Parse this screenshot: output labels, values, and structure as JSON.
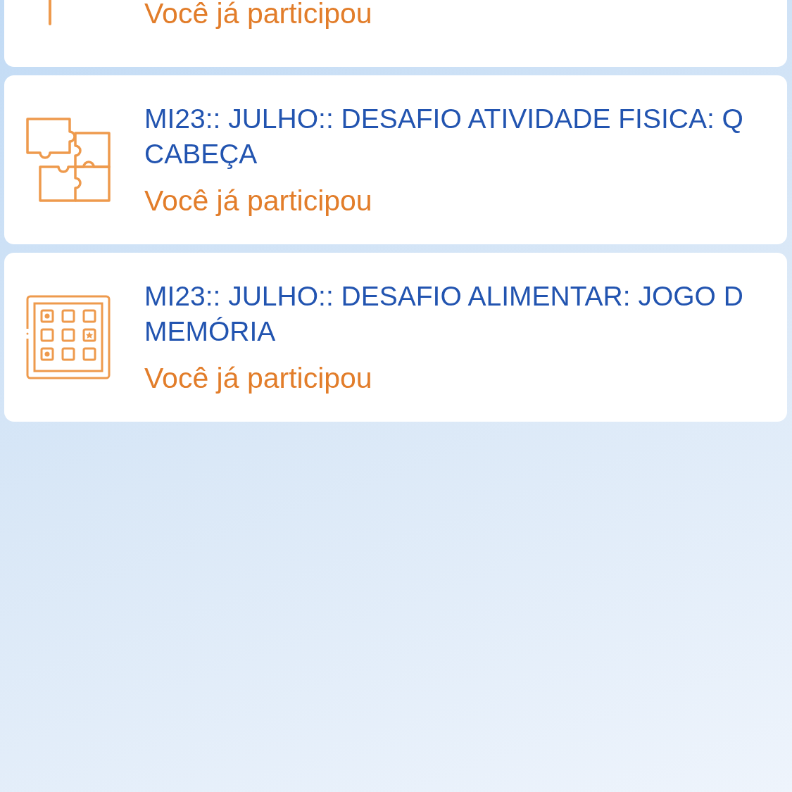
{
  "activities": [
    {
      "kind": "partial",
      "status": "Você já participou"
    },
    {
      "kind": "puzzle",
      "title_lines": [
        "MI23:: JULHO:: DESAFIO ATIVIDADE FISICA: Q",
        "CABEÇA"
      ],
      "status": "Você já participou"
    },
    {
      "kind": "memory",
      "title_lines": [
        "MI23:: JULHO:: DESAFIO ALIMENTAR: JOGO D",
        "MEMÓRIA"
      ],
      "status": "Você já participou"
    }
  ]
}
